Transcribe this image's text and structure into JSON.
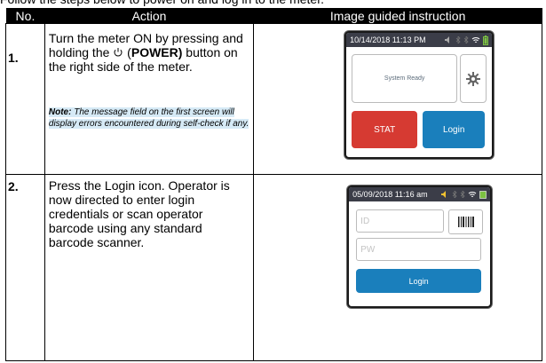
{
  "intro_text": "Follow the steps below to power on and log in to the meter.",
  "table": {
    "headers": [
      "No.",
      "Action",
      "Image guided instruction"
    ],
    "rows": [
      {
        "number": "1.",
        "action_part1": "Turn the meter ON by pressing and holding the ",
        "action_part2": " (",
        "action_bold": "POWER)",
        "action_part3": " button on the right side of the meter.",
        "note_label": "Note:",
        "note_text": " The message field on the first screen will display errors encountered during self-check if any.",
        "device": {
          "datetime": "10/14/2018 11:13 PM",
          "message": "System Ready",
          "stat_label": "STAT",
          "login_label": "Login"
        }
      },
      {
        "number": "2.",
        "action": "Press the Login icon. Operator is now directed to enter login credentials or scan operator barcode using any standard barcode scanner.",
        "device": {
          "datetime": "05/09/2018 11:16 am",
          "id_placeholder": "ID",
          "pw_placeholder": "PW",
          "login_label": "Login"
        }
      }
    ]
  },
  "colors": {
    "status_bar": "#3b3d48",
    "stat_red": "#d63a32",
    "login_blue": "#1a7fbc",
    "note_highlight": "#d6eaf6"
  }
}
